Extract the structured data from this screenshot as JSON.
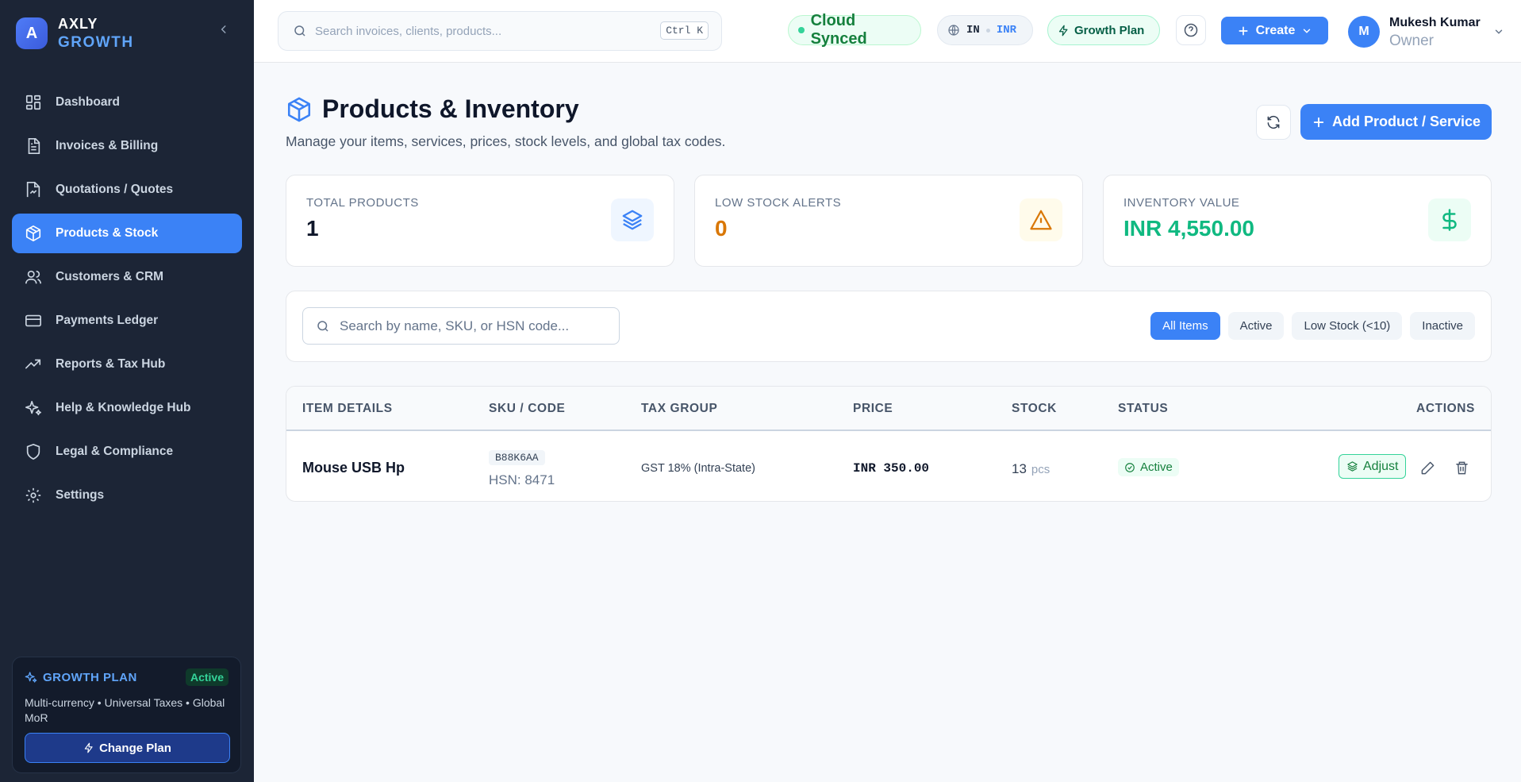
{
  "brand": {
    "logo_letter": "A",
    "name": "AXLY",
    "tagline": "GROWTH"
  },
  "sidebar": {
    "items": [
      {
        "label": "Dashboard",
        "icon": "dashboard-icon"
      },
      {
        "label": "Invoices & Billing",
        "icon": "invoice-icon"
      },
      {
        "label": "Quotations / Quotes",
        "icon": "quote-icon"
      },
      {
        "label": "Products & Stock",
        "icon": "box-icon",
        "active": true
      },
      {
        "label": "Customers & CRM",
        "icon": "users-icon"
      },
      {
        "label": "Payments Ledger",
        "icon": "card-icon"
      },
      {
        "label": "Reports & Tax Hub",
        "icon": "trend-icon"
      },
      {
        "label": "Help & Knowledge Hub",
        "icon": "sparkle-icon"
      },
      {
        "label": "Legal & Compliance",
        "icon": "shield-icon"
      },
      {
        "label": "Settings",
        "icon": "gear-icon"
      }
    ],
    "plan": {
      "title": "GROWTH PLAN",
      "badge": "Active",
      "description": "Multi-currency • Universal Taxes • Global MoR",
      "button": "Change Plan"
    }
  },
  "topbar": {
    "search_placeholder": "Search invoices, clients, products...",
    "shortcut": "Ctrl K",
    "sync_status": "Cloud Synced",
    "region": "IN",
    "currency": "INR",
    "plan_label": "Growth Plan",
    "create_label": "Create",
    "user": {
      "initial": "M",
      "name": "Mukesh Kumar",
      "role": "Owner"
    }
  },
  "page": {
    "title": "Products & Inventory",
    "subtitle": "Manage your items, services, prices, stock levels, and global tax codes.",
    "add_button": "Add Product / Service"
  },
  "stats": [
    {
      "label": "TOTAL PRODUCTS",
      "value": "1",
      "color": "#0f172a",
      "icon": "layers-icon"
    },
    {
      "label": "LOW STOCK ALERTS",
      "value": "0",
      "color": "#d97706",
      "icon": "warning-icon"
    },
    {
      "label": "INVENTORY VALUE",
      "value": "INR 4,550.00",
      "color": "#10b981",
      "icon": "dollar-icon"
    }
  ],
  "filter": {
    "search_placeholder": "Search by name, SKU, or HSN code...",
    "buttons": [
      "All Items",
      "Active",
      "Low Stock (<10)",
      "Inactive"
    ],
    "active": "All Items"
  },
  "table": {
    "columns": [
      "ITEM DETAILS",
      "SKU / CODE",
      "TAX GROUP",
      "PRICE",
      "STOCK",
      "STATUS",
      "ACTIONS"
    ],
    "rows": [
      {
        "name": "Mouse USB Hp",
        "sku": "B88K6AA",
        "hsn": "HSN: 8471",
        "tax": "GST 18% (Intra-State)",
        "price": "INR 350.00",
        "stock": "13",
        "unit": "pcs",
        "status": "Active",
        "adjust_label": "Adjust"
      }
    ]
  },
  "colors": {
    "accent": "#3b82f6",
    "sidebar_bg": "#1c2536",
    "success": "#10b981",
    "warning": "#d97706"
  }
}
